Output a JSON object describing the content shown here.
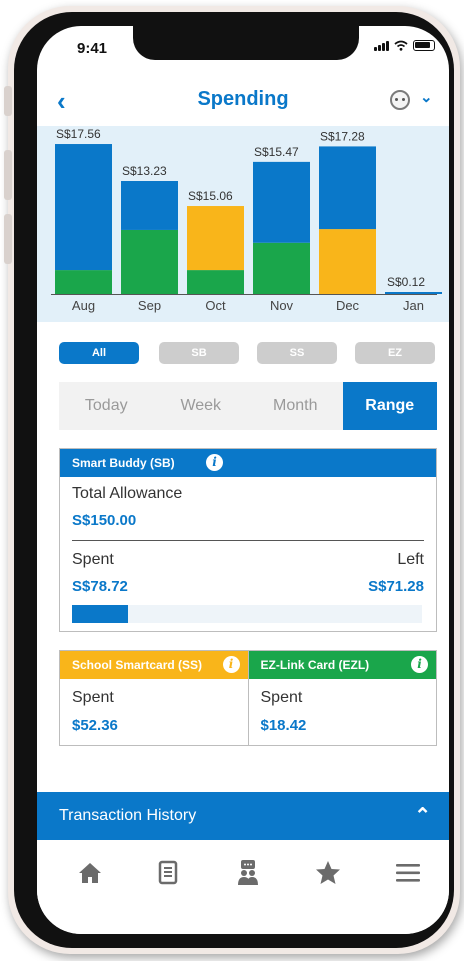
{
  "status": {
    "time": "9:41"
  },
  "header": {
    "title": "Spending"
  },
  "chart_data": {
    "type": "bar",
    "stacked": true,
    "categories": [
      "Aug",
      "Sep",
      "Oct",
      "Nov",
      "Dec",
      "Jan"
    ],
    "totals_labels": [
      "S$17.56",
      "S$13.23",
      "S$15.06",
      "S$15.47",
      "S$17.28",
      "S$0.12"
    ],
    "series": [
      {
        "values": [
          2.8,
          7.5,
          2.8,
          6.0,
          0,
          0
        ],
        "color": "#1aa64b"
      },
      {
        "values": [
          0,
          0,
          7.5,
          0,
          7.6,
          0
        ],
        "color": "#f9b51a"
      },
      {
        "values": [
          14.76,
          5.73,
          0,
          9.47,
          9.68,
          0.12
        ],
        "color": "#0a78c9"
      }
    ],
    "ylim": [
      0,
      18.5
    ],
    "grid": false
  },
  "filters": [
    "All",
    "SB",
    "SS",
    "EZ"
  ],
  "tabs": [
    "Today",
    "Week",
    "Month",
    "Range"
  ],
  "sb_card": {
    "title": "Smart Buddy (SB)",
    "allowance_label": "Total Allowance",
    "allowance_value": "S$150.00",
    "spent_label": "Spent",
    "spent_value": "S$78.72",
    "left_label": "Left",
    "left_value": "S$71.28",
    "progress_fraction": 0.16
  },
  "ss_card": {
    "title": "School Smartcard (SS)",
    "spent_label": "Spent",
    "spent_value": "$52.36",
    "color": "#f9b51a"
  },
  "ez_card": {
    "title": "EZ-Link Card (EZL)",
    "spent_label": "Spent",
    "spent_value": "$18.42",
    "color": "#1aa64b"
  },
  "transactions": {
    "label": "Transaction History"
  },
  "nav_icons": [
    "home-icon",
    "document-icon",
    "chat-person-icon",
    "star-icon",
    "menu-icon"
  ]
}
